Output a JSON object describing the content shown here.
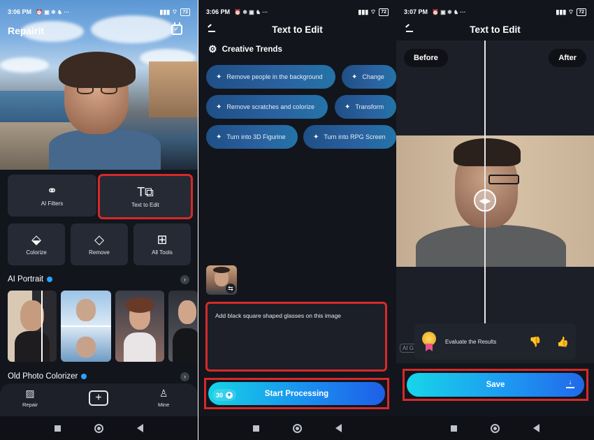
{
  "screens": {
    "home": {
      "status": {
        "time": "3:06 PM",
        "battery": "72"
      },
      "app_title": "Repairit",
      "features": {
        "ai_filters": "AI Filters",
        "text_to_edit": "Text to Edit",
        "colorize": "Colorize",
        "remove": "Remove",
        "all_tools": "All Tools"
      },
      "sections": {
        "ai_portrait": "AI Portrait",
        "old_photo_colorizer": "Old Photo Colorizer"
      },
      "tabs": {
        "repair": "Repair",
        "mine": "Mine"
      }
    },
    "text_edit": {
      "status": {
        "time": "3:06 PM",
        "battery": "72"
      },
      "title": "Text to Edit",
      "trends_title": "Creative Trends",
      "pills": [
        "Remove people in the background",
        "Change",
        "Remove scratches and colorize",
        "Transform",
        "Turn into 3D Figurine",
        "Turn into RPG Screen"
      ],
      "prompt": "Add black square shaped glasses on this image",
      "credits": "30",
      "start_label": "Start Processing"
    },
    "result": {
      "status": {
        "time": "3:07 PM",
        "battery": "72"
      },
      "title": "Text to Edit",
      "before_label": "Before",
      "after_label": "After",
      "evaluate_label": "Evaluate the Results",
      "ai_chip": "AI G",
      "save_label": "Save"
    }
  },
  "colors": {
    "highlight": "#d62a2a",
    "accent_start": "#15d3e6",
    "accent_end": "#1e5fe8",
    "background": "#12151c"
  },
  "icons": [
    "calendar-check-icon",
    "filters-icon",
    "text-edit-icon",
    "colorize-icon",
    "eraser-icon",
    "grid-icon",
    "gear-icon",
    "sparkle-icon",
    "swap-icon",
    "medal-icon",
    "thumbs-down-icon",
    "thumbs-up-icon",
    "download-icon"
  ]
}
